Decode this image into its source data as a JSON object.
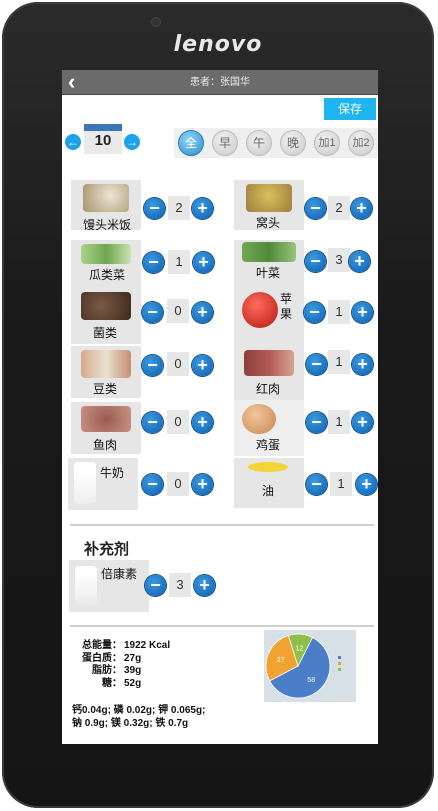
{
  "device": {
    "brand": "lenovo"
  },
  "header": {
    "back_icon": "chevron-left-icon",
    "patient_label": "患者：张国华"
  },
  "toolbar": {
    "save_label": "保存"
  },
  "date_nav": {
    "day": "10"
  },
  "meal_tabs": [
    {
      "label": "全",
      "active": true
    },
    {
      "label": "早",
      "active": false
    },
    {
      "label": "午",
      "active": false
    },
    {
      "label": "晚",
      "active": false
    },
    {
      "label": "加1",
      "active": false
    },
    {
      "label": "加2",
      "active": false
    }
  ],
  "foods": [
    {
      "name": "馒头米饭",
      "qty": "2"
    },
    {
      "name": "窝头",
      "qty": "2"
    },
    {
      "name": "瓜类菜",
      "qty": "1"
    },
    {
      "name": "叶菜",
      "qty": "3"
    },
    {
      "name": "菌类",
      "qty": "0"
    },
    {
      "name": "苹果",
      "qty": "1"
    },
    {
      "name": "豆类",
      "qty": "0"
    },
    {
      "name": "红肉",
      "qty": "1"
    },
    {
      "name": "鱼肉",
      "qty": "0"
    },
    {
      "name": "鸡蛋",
      "qty": "1"
    },
    {
      "name": "牛奶",
      "qty": "0"
    },
    {
      "name": "油",
      "qty": "1"
    }
  ],
  "supplements": {
    "title": "补充剂",
    "items": [
      {
        "name": "倍康素",
        "qty": "3"
      }
    ]
  },
  "summary": {
    "energy_label": "总能量：",
    "energy_value": "1922 Kcal",
    "protein_label": "蛋白质：",
    "protein_value": "27g",
    "fat_label": "脂肪：",
    "fat_value": "39g",
    "sugar_label": "糖：",
    "sugar_value": "52g",
    "minerals_line1": "钙0.04g; 磷 0.02g; 钾 0.065g;",
    "minerals_line2": "钠 0.9g; 镁 0.32g; 铁 0.7g"
  },
  "chart_data": {
    "type": "pie",
    "values": [
      58,
      27,
      12
    ],
    "labels": [
      "58",
      "27",
      "12"
    ],
    "colors": [
      "#4a7fc8",
      "#f0a330",
      "#8fbf4a"
    ]
  },
  "colors": {
    "accent": "#1eb4ef",
    "button": "#0d5fb0",
    "header": "#6b6b6b"
  }
}
